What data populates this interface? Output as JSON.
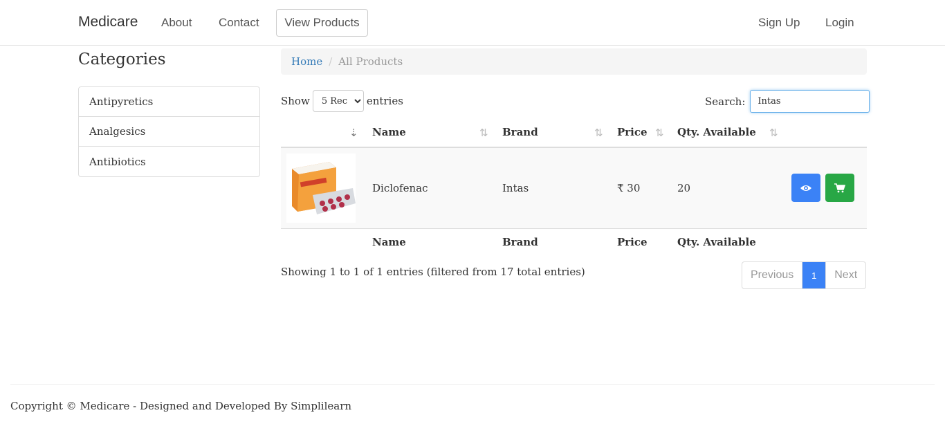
{
  "navbar": {
    "brand": "Medicare",
    "links": [
      "About",
      "Contact"
    ],
    "view_products": "View Products",
    "right_links": [
      "Sign Up",
      "Login"
    ]
  },
  "sidebar": {
    "title": "Categories",
    "items": [
      "Antipyretics",
      "Analgesics",
      "Antibiotics"
    ]
  },
  "breadcrumb": {
    "home": "Home",
    "separator": "/",
    "current": "All Products"
  },
  "table_controls": {
    "show_label": "Show",
    "entries_label": "entries",
    "page_size": "5 Rec",
    "search_label": "Search:",
    "search_value": "Intas"
  },
  "table": {
    "columns": [
      "Name",
      "Brand",
      "Price",
      "Qty. Available"
    ],
    "rows": [
      {
        "name": "Diclofenac",
        "brand": "Intas",
        "price": "₹ 30",
        "qty": "20",
        "image": "diclofenac-pack"
      }
    ]
  },
  "pagination": {
    "info": "Showing 1 to 1 of 1 entries (filtered from 17 total entries)",
    "previous": "Previous",
    "current": "1",
    "next": "Next"
  },
  "colors": {
    "view_button": "#3b82f6",
    "cart_button": "#28a745",
    "link": "#337ab7"
  },
  "icons": {
    "view": "eye-icon",
    "cart": "cart-icon",
    "sort": "sort-icon"
  },
  "footer": {
    "text": "Copyright © Medicare - Designed and Developed By Simplilearn"
  }
}
